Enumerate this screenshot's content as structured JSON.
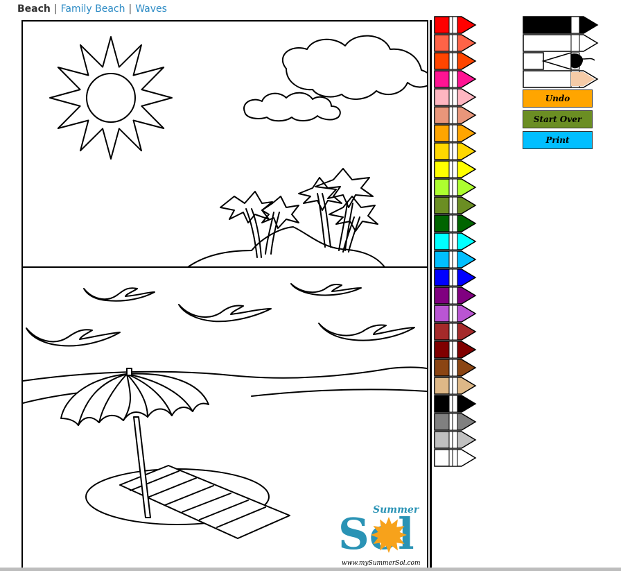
{
  "breadcrumb": {
    "current": "Beach",
    "links": [
      "Family Beach",
      "Waves"
    ],
    "separator": "|"
  },
  "canvas": {
    "logo_top": "Summer",
    "logo_bottom": "Sol",
    "logo_url": "www.mySummerSol.com",
    "logo_color": "#2a93b5",
    "sun_color": "#f7a21b"
  },
  "palette": [
    {
      "name": "red",
      "color": "#ff0000"
    },
    {
      "name": "coral",
      "color": "#ff6347"
    },
    {
      "name": "orange-red",
      "color": "#ff4500"
    },
    {
      "name": "deep-pink",
      "color": "#ff1493"
    },
    {
      "name": "pink",
      "color": "#ffb6c1"
    },
    {
      "name": "dark-salmon",
      "color": "#e9967a"
    },
    {
      "name": "orange",
      "color": "#ffa500"
    },
    {
      "name": "gold",
      "color": "#ffd700"
    },
    {
      "name": "yellow",
      "color": "#ffff00"
    },
    {
      "name": "green-yellow",
      "color": "#adff2f"
    },
    {
      "name": "olive-drab",
      "color": "#6b8e23"
    },
    {
      "name": "dark-green",
      "color": "#006400"
    },
    {
      "name": "cyan",
      "color": "#00ffff"
    },
    {
      "name": "deep-sky-blue",
      "color": "#00bfff"
    },
    {
      "name": "blue",
      "color": "#0000ff"
    },
    {
      "name": "purple",
      "color": "#800080"
    },
    {
      "name": "medium-orchid",
      "color": "#ba55d3"
    },
    {
      "name": "brown",
      "color": "#a52a2a"
    },
    {
      "name": "maroon",
      "color": "#800000"
    },
    {
      "name": "saddle-brown",
      "color": "#8b4513"
    },
    {
      "name": "burlywood",
      "color": "#deb887"
    },
    {
      "name": "black",
      "color": "#000000"
    },
    {
      "name": "gray",
      "color": "#808080"
    },
    {
      "name": "silver",
      "color": "#c0c0c0"
    },
    {
      "name": "white",
      "color": "#ffffff"
    }
  ],
  "tools": [
    {
      "name": "large-brush",
      "icon": "large-crayon-icon",
      "color": "#000000"
    },
    {
      "name": "eraser",
      "icon": "eraser-icon",
      "color": "#ffffff"
    },
    {
      "name": "paint-bucket",
      "icon": "paint-bucket-icon",
      "color": "#000000"
    },
    {
      "name": "current-color",
      "icon": "current-color-crayon-icon",
      "color": "#f5cba7"
    }
  ],
  "buttons": {
    "undo": {
      "label": "Undo",
      "color": "#ffa500"
    },
    "start_over": {
      "label": "Start Over",
      "color": "#6b8e23"
    },
    "print": {
      "label": "Print",
      "color": "#00bfff"
    }
  }
}
